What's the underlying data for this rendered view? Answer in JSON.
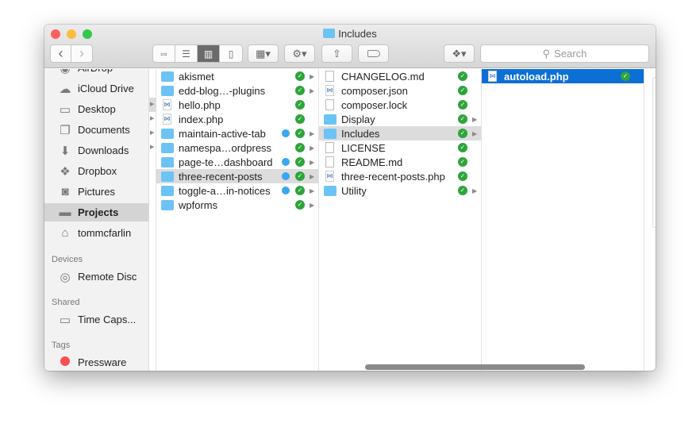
{
  "window": {
    "title": "Includes",
    "traffic_lights": [
      "#fc605b",
      "#fdbc40",
      "#34c84a"
    ]
  },
  "toolbar": {
    "back": "‹",
    "forward": "›",
    "view_modes": [
      "icon",
      "list",
      "column",
      "cover-flow"
    ],
    "active_view": "column",
    "search_placeholder": "Search"
  },
  "sidebar": {
    "favorites": [
      {
        "label": "AirDrop",
        "icon": "airdrop-icon"
      },
      {
        "label": "iCloud Drive",
        "icon": "cloud-icon"
      },
      {
        "label": "Desktop",
        "icon": "desktop-icon"
      },
      {
        "label": "Documents",
        "icon": "documents-icon"
      },
      {
        "label": "Downloads",
        "icon": "downloads-icon"
      },
      {
        "label": "Dropbox",
        "icon": "dropbox-icon"
      },
      {
        "label": "Pictures",
        "icon": "camera-icon"
      },
      {
        "label": "Projects",
        "icon": "folder-icon",
        "selected": true
      },
      {
        "label": "tommcfarlin",
        "icon": "home-icon"
      }
    ],
    "devices_header": "Devices",
    "devices": [
      {
        "label": "Remote Disc"
      }
    ],
    "shared_header": "Shared",
    "shared": [
      {
        "label": "Time Caps..."
      }
    ],
    "tags_header": "Tags",
    "tags": [
      {
        "label": "Pressware",
        "color": "#fc4f4f"
      }
    ]
  },
  "columns": [
    [
      {
        "name": "akismet",
        "type": "folder",
        "tag": false,
        "arrow": true
      },
      {
        "name": "edd-blog…-plugins",
        "type": "folder",
        "tag": false,
        "arrow": true
      },
      {
        "name": "hello.php",
        "type": "code",
        "tag": false,
        "arrow": false
      },
      {
        "name": "index.php",
        "type": "code",
        "tag": false,
        "arrow": false
      },
      {
        "name": "maintain-active-tab",
        "type": "folder",
        "tag": true,
        "arrow": true
      },
      {
        "name": "namespa…ordpress",
        "type": "folder",
        "tag": false,
        "arrow": true
      },
      {
        "name": "page-te…dashboard",
        "type": "folder",
        "tag": true,
        "arrow": true
      },
      {
        "name": "three-recent-posts",
        "type": "folder",
        "tag": true,
        "arrow": true,
        "highlight": true
      },
      {
        "name": "toggle-a…in-notices",
        "type": "folder",
        "tag": true,
        "arrow": true
      },
      {
        "name": "wpforms",
        "type": "folder",
        "tag": false,
        "arrow": true
      }
    ],
    [
      {
        "name": "CHANGELOG.md",
        "type": "doc",
        "arrow": false
      },
      {
        "name": "composer.json",
        "type": "code",
        "arrow": false
      },
      {
        "name": "composer.lock",
        "type": "doc",
        "arrow": false
      },
      {
        "name": "Display",
        "type": "folder",
        "arrow": true
      },
      {
        "name": "Includes",
        "type": "folder",
        "arrow": true,
        "highlight": true
      },
      {
        "name": "LICENSE",
        "type": "doc",
        "arrow": false
      },
      {
        "name": "README.md",
        "type": "doc",
        "arrow": false
      },
      {
        "name": "three-recent-posts.php",
        "type": "code",
        "arrow": false
      },
      {
        "name": "Utility",
        "type": "folder",
        "arrow": true
      }
    ],
    [
      {
        "name": "autoload.php",
        "type": "code",
        "arrow": false,
        "selected": true
      }
    ]
  ],
  "colors": {
    "selection": "#0b6fd6",
    "sync_ok": "#2ea43a",
    "tag_blue": "#3aa7f0",
    "folder": "#6cc3f5"
  }
}
